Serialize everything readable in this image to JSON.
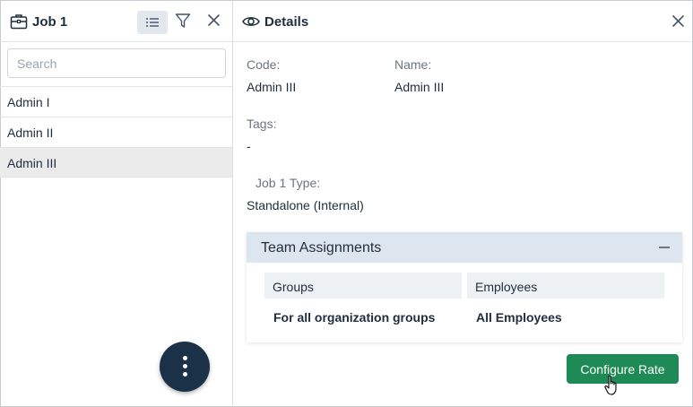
{
  "left_panel": {
    "title": "Job 1",
    "search": {
      "placeholder": "Search",
      "value": ""
    },
    "items": [
      {
        "label": "Admin I",
        "selected": false
      },
      {
        "label": "Admin II",
        "selected": false
      },
      {
        "label": "Admin III",
        "selected": true
      }
    ]
  },
  "details": {
    "title": "Details",
    "code_label": "Code:",
    "code_value": "Admin III",
    "name_label": "Name:",
    "name_value": "Admin III",
    "tags_label": "Tags:",
    "tags_value": "-",
    "type_label": "Job 1 Type:",
    "type_value": "Standalone (Internal)"
  },
  "team_assignments": {
    "title": "Team Assignments",
    "groups_header": "Groups",
    "groups_value": "For all organization groups",
    "employees_header": "Employees",
    "employees_value": "All Employees"
  },
  "actions": {
    "configure_rate_label": "Configure Rate"
  },
  "colors": {
    "primary_button": "#1e8a56",
    "fab": "#1b3147",
    "section_header": "#dde6ef",
    "selected_row": "#ebebeb"
  }
}
